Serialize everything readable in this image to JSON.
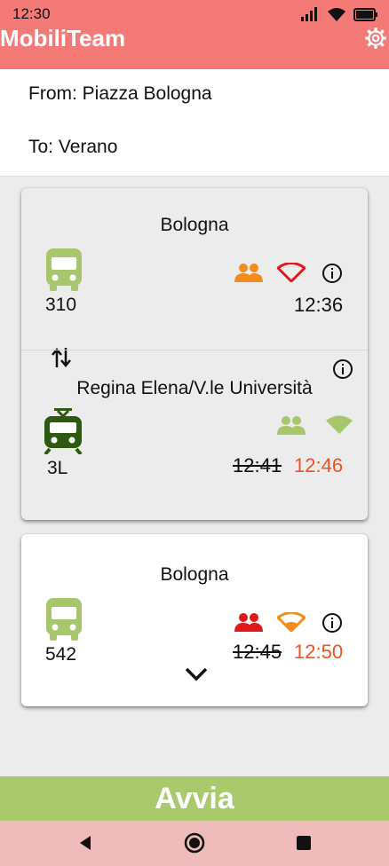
{
  "status_bar": {
    "time": "12:30"
  },
  "app": {
    "title": "MobiliTeam"
  },
  "route": {
    "from": "From: Piazza Bologna",
    "to": "To: Verano"
  },
  "card1": {
    "leg1": {
      "stop": "Bologna",
      "line": "310",
      "time": "12:36"
    },
    "leg2": {
      "stop": "Regina Elena/V.le Università",
      "line": "3L",
      "scheduled": "12:41",
      "actual": "12:46"
    }
  },
  "card2": {
    "stop": "Bologna",
    "line": "542",
    "scheduled": "12:45",
    "actual": "12:50"
  },
  "start_button": {
    "label": "Avvia"
  },
  "colors": {
    "appbar": "#f47a78",
    "bus": "#a8c66c",
    "tram": "#2d5a10",
    "start": "#a9c96c",
    "late": "#f4511e",
    "navbar": "#f0bcbb"
  }
}
